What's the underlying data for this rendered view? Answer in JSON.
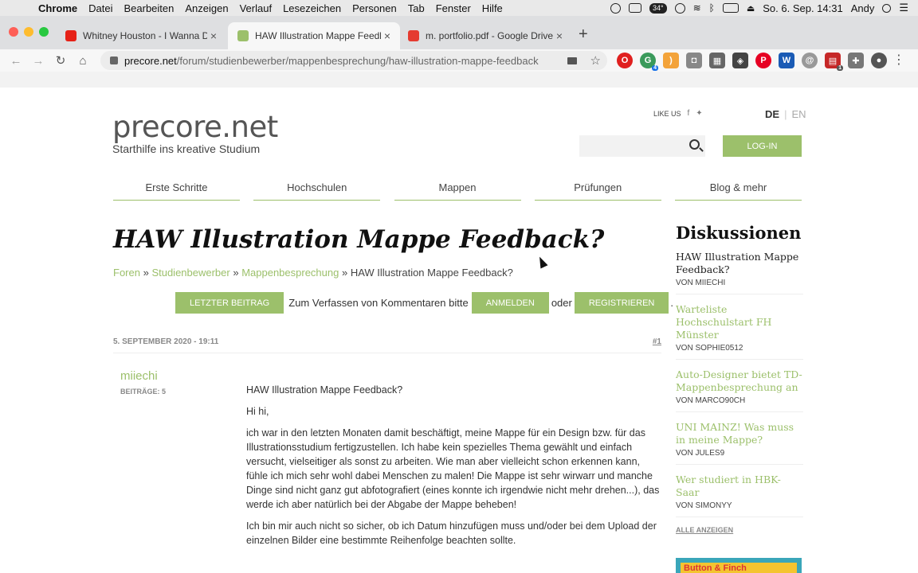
{
  "menubar": {
    "app": "Chrome",
    "items": [
      "Datei",
      "Bearbeiten",
      "Anzeigen",
      "Verlauf",
      "Lesezeichen",
      "Personen",
      "Tab",
      "Fenster",
      "Hilfe"
    ],
    "temperature": "34°",
    "datetime": "So. 6. Sep. 14:31",
    "user": "Andy"
  },
  "tabs": [
    {
      "title": "Whitney Houston - I Wanna Dance",
      "icon": "youtube-icon"
    },
    {
      "title": "HAW Illustration Mappe Feedback?",
      "icon": "precore-icon"
    },
    {
      "title": "m. portfolio.pdf - Google Drive",
      "icon": "pdf-icon"
    }
  ],
  "address": {
    "host": "precore.net",
    "path": "/forum/studienbewerber/mappenbesprechung/haw-illustration-mappe-feedback"
  },
  "extensions": {
    "badge_green": "4",
    "badge_red": "1"
  },
  "site": {
    "logo": "precore.net",
    "tagline": "Starthilfe ins kreative Studium",
    "like_us": "LIKE US",
    "lang_de": "DE",
    "lang_en": "EN",
    "login": "LOG-IN",
    "nav": [
      "Erste Schritte",
      "Hochschulen",
      "Mappen",
      "Prüfungen",
      "Blog & mehr"
    ]
  },
  "thread": {
    "title": "HAW Illustration Mappe Feedback?",
    "breadcrumb": [
      "Foren",
      "Studienbewerber",
      "Mappenbesprechung"
    ],
    "breadcrumb_current": "HAW Illustration Mappe Feedback?",
    "last_post_btn": "LETZTER BEITRAG",
    "compose_text": "Zum Verfassen von Kommentaren bitte",
    "signin_btn": "ANMELDEN",
    "or_text": "oder",
    "register_btn": "REGISTRIEREN",
    "post": {
      "date": "5. SEPTEMBER 2020 - 19:11",
      "number": "#1",
      "author": "miiechi",
      "author_posts": "BEITRÄGE: 5",
      "paragraphs": [
        "HAW Illustration Mappe Feedback?",
        "Hi hi,",
        "ich war in den letzten Monaten damit beschäftigt, meine Mappe für ein Design bzw. für das Illustrationsstudium fertigzustellen. Ich habe kein spezielles Thema gewählt und einfach versucht, vielseitiger als sonst zu arbeiten. Wie man aber vielleicht schon erkennen kann, fühle ich mich sehr wohl dabei Menschen zu malen! Die Mappe ist sehr wirwarr und manche Dinge sind nicht ganz gut abfotografiert (eines konnte ich irgendwie nicht mehr drehen...), das werde ich aber natürlich bei der Abgabe der Mappe beheben!",
        "Ich bin mir auch nicht so sicher, ob ich Datum hinzufügen muss und/oder bei dem Upload der einzelnen Bilder eine bestimmte Reihenfolge beachten sollte."
      ]
    }
  },
  "sidebar": {
    "heading": "Diskussionen",
    "items": [
      {
        "title": "HAW Illustration Mappe Feedback?",
        "by": "VON MIIECHI"
      },
      {
        "title": "Warteliste Hochschulstart FH Münster",
        "by": "VON SOPHIE0512"
      },
      {
        "title": "Auto-Designer bietet TD-Mappenbesprechung an",
        "by": "VON MARCO90CH"
      },
      {
        "title": "UNI MAINZ! Was muss in meine Mappe?",
        "by": "VON JULES9"
      },
      {
        "title": "Wer studiert in HBK-Saar",
        "by": "VON SIMONYY"
      }
    ],
    "show_all": "ALLE ANZEIGEN",
    "banner": "Button & Finch"
  }
}
